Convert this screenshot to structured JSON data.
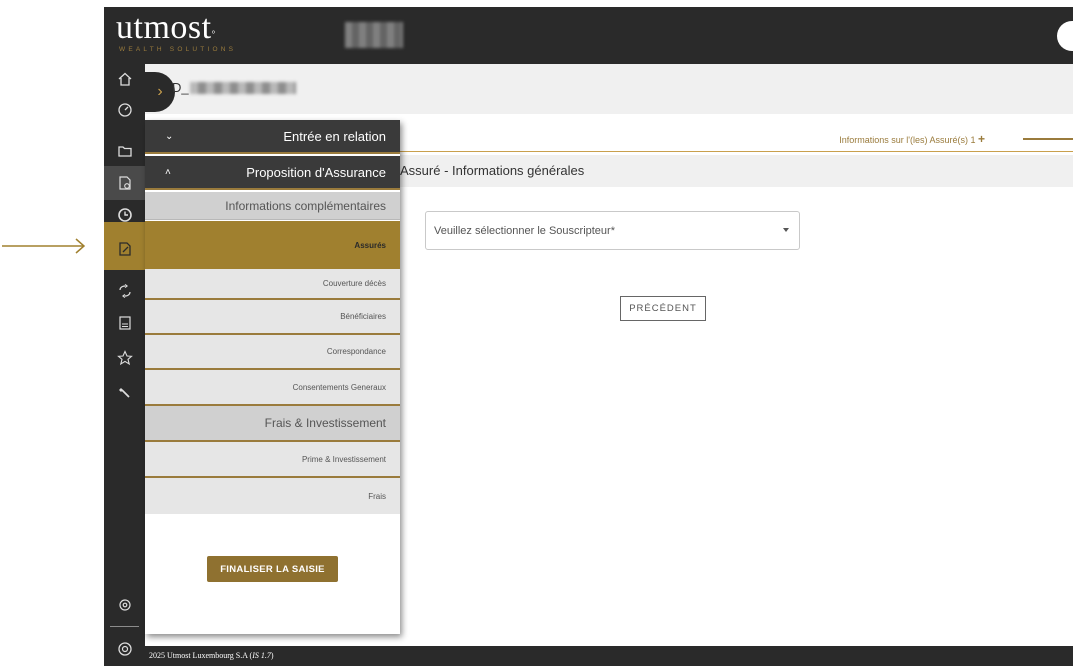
{
  "brand": {
    "logo_text": "utmost",
    "logo_mark": "°",
    "logo_subtitle": "WEALTH SOLUTIONS"
  },
  "breadcrumb": {
    "prefix": "D_"
  },
  "tabs": {
    "info_label": "Informations sur l'(les) Assuré(s) 1",
    "plus": "+"
  },
  "section": {
    "title": "Assuré - Informations générales"
  },
  "souscripteur": {
    "placeholder": "Veuillez sélectionner le Souscripteur*"
  },
  "buttons": {
    "prev": "PRÉCÉDENT",
    "finalize": "FINALISER LA SAISIE"
  },
  "menu": {
    "entree": "Entrée en relation",
    "proposition": "Proposition d'Assurance",
    "info_comp": "Informations complémentaires",
    "assures": "Assurés",
    "couverture": "Couverture décès",
    "beneficiaires": "Bénéficiaires",
    "correspondance": "Correspondance",
    "consentements": "Consentements Generaux",
    "frais_invest": "Frais & Investissement",
    "prime_invest": "Prime & Investissement",
    "frais": "Frais"
  },
  "footer": {
    "text": "2025 Utmost Luxembourg S.A (",
    "version": "IS 1.7",
    "text_end": ")"
  },
  "colors": {
    "gold": "#9a7b3c",
    "gold_active": "#a0802f",
    "dark": "#2a2a2a"
  },
  "icons": [
    "home-icon",
    "dashboard-icon",
    "folder-icon",
    "document-gear-icon",
    "clock-arrow-icon",
    "edit-document-icon",
    "transfer-icon",
    "calculator-doc-icon",
    "star-icon",
    "tool-icon",
    "settings-icon",
    "account-icon"
  ]
}
